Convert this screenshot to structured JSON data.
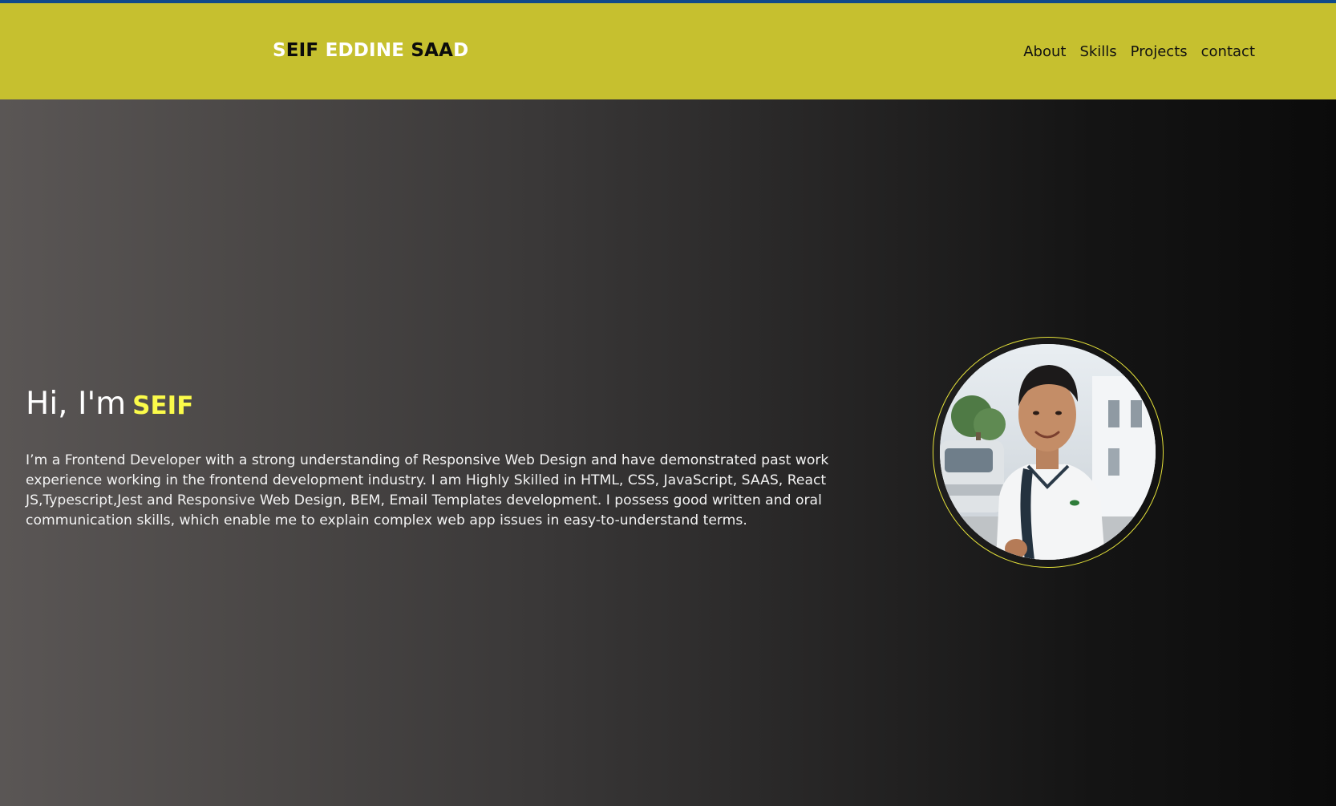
{
  "header": {
    "logo": {
      "segments": [
        {
          "text": "S",
          "tone": "light"
        },
        {
          "text": "EIF",
          "tone": "dark"
        },
        {
          "text": " EDDINE ",
          "tone": "light"
        },
        {
          "text": "SAA",
          "tone": "dark"
        },
        {
          "text": "D",
          "tone": "light"
        }
      ]
    },
    "nav": [
      {
        "label": "About"
      },
      {
        "label": "Skills"
      },
      {
        "label": "Projects"
      },
      {
        "label": "contact"
      }
    ]
  },
  "hero": {
    "greeting": "Hi, I'm",
    "name": "SEIF",
    "bio": "I’m a Frontend Developer with a strong understanding of Responsive Web Design and have demonstrated past work experience working in the frontend development industry. I am Highly Skilled in HTML, CSS, JavaScript, SAAS, React JS,Typescript,Jest and Responsive Web Design, BEM, Email Templates development. I possess good written and oral communication skills, which enable me to explain complex web app issues in easy-to-understand terms."
  },
  "colors": {
    "top_strip": "#0f4a8a",
    "navbar_bg": "#c6c02f",
    "logo_light": "#ffffff",
    "logo_dark": "#0c0c0c",
    "accent_name": "#fbfb4a",
    "avatar_ring": "#e6e33a",
    "hero_gradient_start": "#5a5655",
    "hero_gradient_end": "#0b0b0b"
  }
}
